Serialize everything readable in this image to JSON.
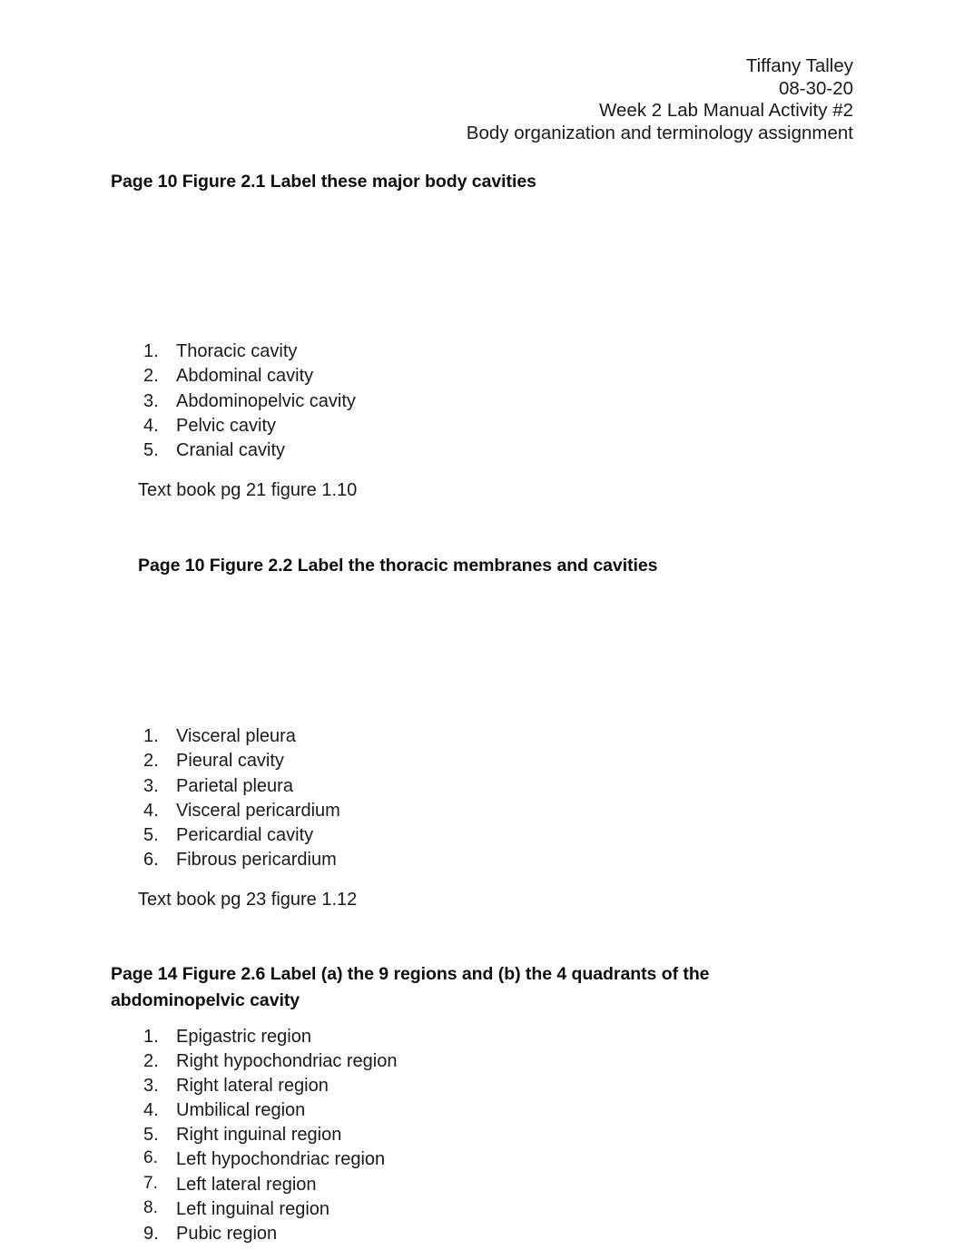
{
  "document": {
    "header_lines": [
      "Tiffany Talley",
      "08-30-20",
      "Week 2 Lab Manual Activity #2",
      "Body organization and terminology assignment"
    ]
  },
  "sections": [
    {
      "heading": "Page 10 Figure 2.1 Label these major body cavities",
      "items": [
        {
          "num": "1.",
          "label": "Thoracic cavity"
        },
        {
          "num": "2.",
          "label": "Abdominal cavity"
        },
        {
          "num": "3.",
          "label": "Abdominopelvic cavity"
        },
        {
          "num": "4.",
          "label": "Pelvic cavity"
        },
        {
          "num": "5.",
          "label": "Cranial cavity"
        }
      ],
      "reference": "Text book pg 21 figure 1.10"
    },
    {
      "heading": "Page 10 Figure 2.2 Label the thoracic membranes and cavities",
      "items": [
        {
          "num": "1.",
          "label": "Visceral pleura"
        },
        {
          "num": "2.",
          "label": "Pieural cavity"
        },
        {
          "num": "3.",
          "label": "Parietal pleura"
        },
        {
          "num": "4.",
          "label": "Visceral pericardium"
        },
        {
          "num": "5.",
          "label": "Pericardial cavity"
        },
        {
          "num": "6.",
          "label": "Fibrous pericardium"
        }
      ],
      "reference": "Text book pg 23 figure 1.12"
    },
    {
      "heading": "Page 14 Figure 2.6 Label (a) the 9 regions and (b) the 4 quadrants of the abdominopelvic cavity",
      "items": [
        {
          "num": "1.",
          "label": "Epigastric region"
        },
        {
          "num": "2.",
          "label": "Right hypochondriac region"
        },
        {
          "num": "3.",
          "label": "Right lateral region"
        },
        {
          "num": "4.",
          "label": "Umbilical region"
        },
        {
          "num": "5.",
          "label": "Right inguinal region"
        },
        {
          "num": "6.",
          "label": "Left hypochondriac region"
        },
        {
          "num": "7.",
          "label": "Left lateral region"
        },
        {
          "num": "8.",
          "label": "Left inguinal region"
        },
        {
          "num": "9.",
          "label": "Pubic region"
        }
      ]
    }
  ]
}
